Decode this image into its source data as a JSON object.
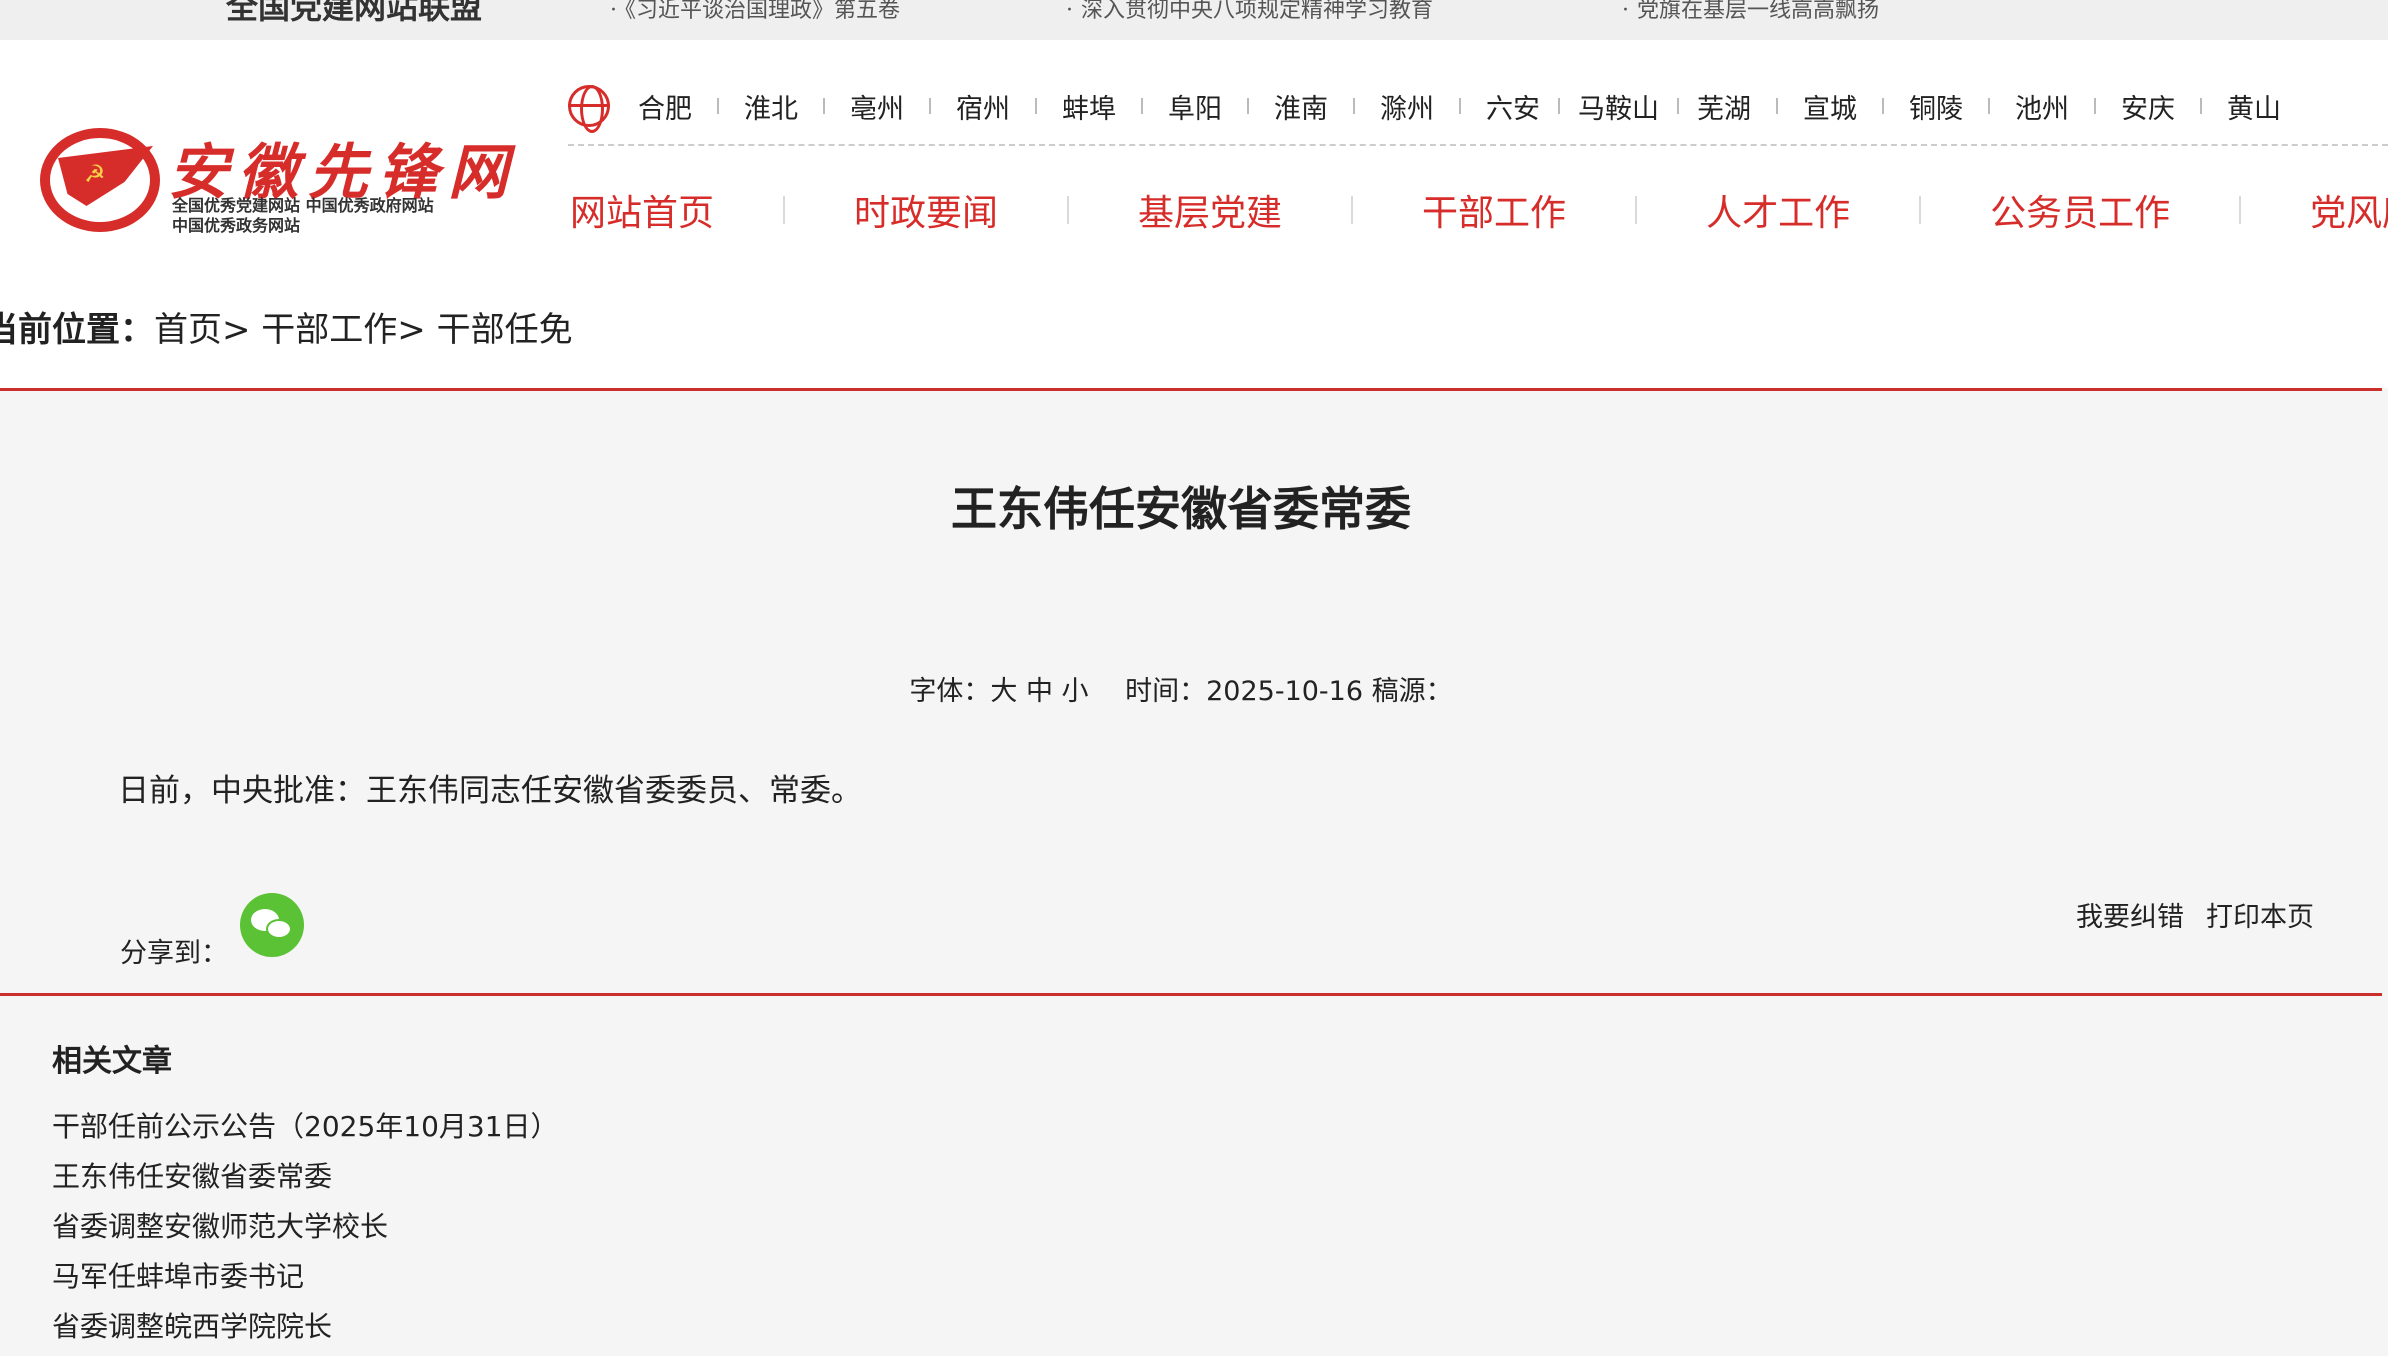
{
  "topbar": {
    "alliance": "全国党建网站联盟",
    "news": [
      "《习近平谈治国理政》第五卷",
      "深入贯彻中央八项规定精神学习教育",
      "党旗在基层一线高高飘扬"
    ]
  },
  "logo": {
    "name": "安徽先锋网",
    "sub_line1": "全国优秀党建网站  中国优秀政府网站",
    "sub_line2": "中国优秀政务网站"
  },
  "cities": [
    "合肥",
    "淮北",
    "亳州",
    "宿州",
    "蚌埠",
    "阜阳",
    "淮南",
    "滁州",
    "六安",
    "马鞍山",
    "芜湖",
    "宣城",
    "铜陵",
    "池州",
    "安庆",
    "黄山"
  ],
  "nav": [
    "网站首页",
    "时政要闻",
    "基层党建",
    "干部工作",
    "人才工作",
    "公务员工作",
    "党风廉政"
  ],
  "breadcrumb": {
    "lead": "当前位置：",
    "path": "首页> 干部工作> 干部任免"
  },
  "article": {
    "title": "王东伟任安徽省委常委",
    "font_label": "字体：",
    "font_sizes": [
      "大",
      "中",
      "小"
    ],
    "time_label": "时间：",
    "date": "2025-10-16",
    "source_label": "稿源：",
    "body": "日前，中央批准：王东伟同志任安徽省委委员、常委。",
    "share_label": "分享到：",
    "report_error": "我要纠错",
    "print": "打印本页"
  },
  "related": {
    "title": "相关文章",
    "items": [
      "干部任前公示公告（2025年10月31日）",
      "王东伟任安徽省委常委",
      "省委调整安徽师范大学校长",
      "马军任蚌埠市委书记",
      "省委调整皖西学院院长"
    ]
  },
  "colors": {
    "accent_red": "#d72d2a",
    "wechat_green": "#5bc236"
  }
}
